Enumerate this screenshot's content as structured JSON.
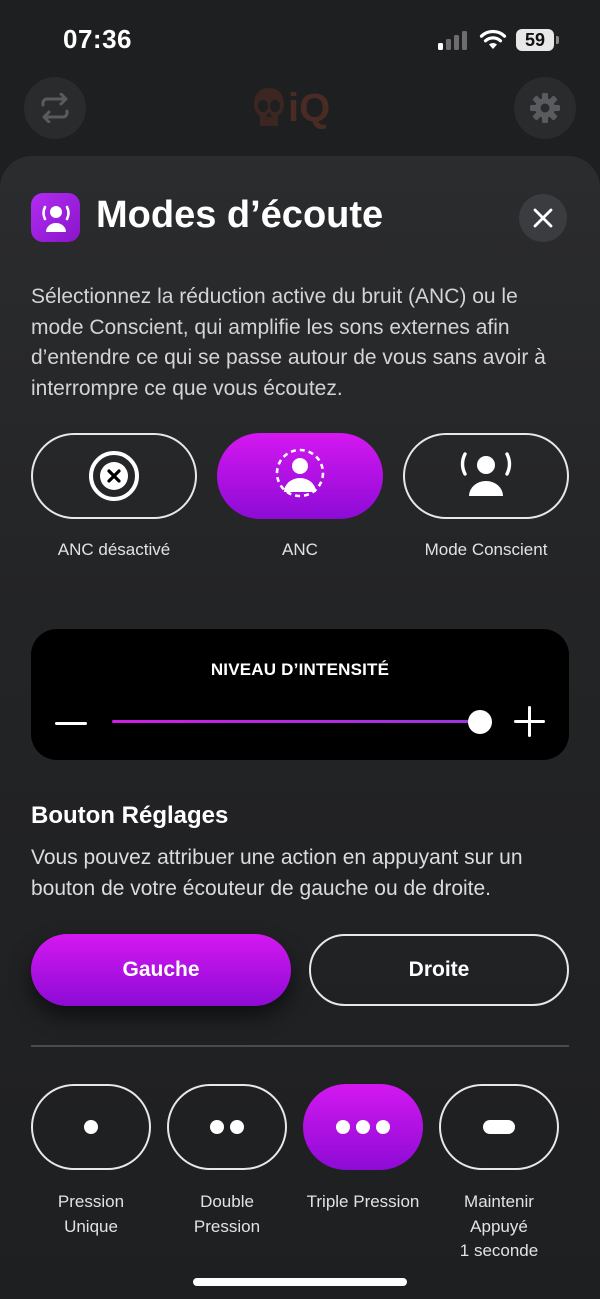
{
  "status_bar": {
    "time": "07:36",
    "battery": "59",
    "icons": [
      "signal-icon",
      "wifi-icon",
      "battery-icon"
    ]
  },
  "header": {
    "brand": "iQ",
    "left_icon": "swap-arrows-icon",
    "right_icon": "gear-icon"
  },
  "sheet": {
    "title": "Modes d’écoute",
    "title_icon": "listening-mode-icon",
    "close_icon": "close-icon",
    "description": "Sélectionnez la réduction active du bruit (ANC) ou le mode Conscient, qui amplifie les sons externes afin d’entendre ce qui se passe autour de vous sans avoir à interrompre ce que vous écoutez.",
    "modes": [
      {
        "label": "ANC désactivé",
        "icon": "anc-off-icon",
        "active": false
      },
      {
        "label": "ANC",
        "icon": "anc-on-icon",
        "active": true
      },
      {
        "label": "Mode Conscient",
        "icon": "aware-mode-icon",
        "active": false
      }
    ]
  },
  "intensity": {
    "title": "NIVEAU D’INTENSITÉ",
    "level": 1.0
  },
  "button_settings": {
    "title": "Bouton Réglages",
    "description": "Vous pouvez attribuer une action en appuyant sur un bouton de votre écouteur de gauche ou de droite.",
    "sides": [
      {
        "label": "Gauche",
        "active": true
      },
      {
        "label": "Droite",
        "active": false
      }
    ],
    "presses": [
      {
        "line1": "Pression",
        "line2": "Unique",
        "line3": "",
        "icon": "single-dot-icon",
        "active": false
      },
      {
        "line1": "Double",
        "line2": "Pression",
        "line3": "",
        "icon": "double-dot-icon",
        "active": false
      },
      {
        "line1": "Triple Pression",
        "line2": "",
        "line3": "",
        "icon": "triple-dot-icon",
        "active": true
      },
      {
        "line1": "Maintenir",
        "line2": "Appuyé",
        "line3": "1 seconde",
        "icon": "hold-icon",
        "active": false
      }
    ]
  },
  "colors": {
    "accent_top": "#d418f0",
    "accent_bottom": "#8d0bd6",
    "background": "#1e1f21"
  }
}
